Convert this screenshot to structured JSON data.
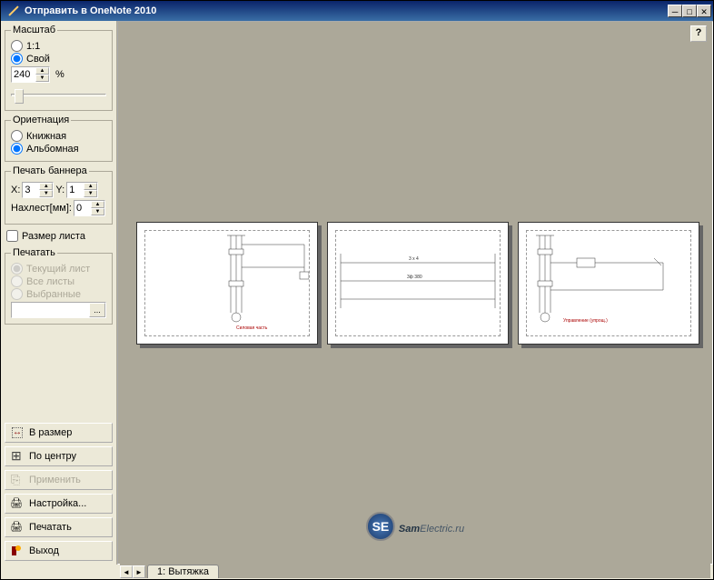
{
  "window": {
    "title": "Отправить в OneNote 2010"
  },
  "scale": {
    "legend": "Масштаб",
    "opt_11": "1:1",
    "opt_custom": "Свой",
    "value": "240",
    "pct": "%"
  },
  "orient": {
    "legend": "Ориетнация",
    "portrait": "Книжная",
    "landscape": "Альбомная"
  },
  "banner": {
    "legend": "Печать баннера",
    "x_label": "X:",
    "x_value": "3",
    "y_label": "Y:",
    "y_value": "1",
    "overlap_label": "Нахлест[мм]:",
    "overlap_value": "0"
  },
  "sheet_size": "Размер листа",
  "print": {
    "legend": "Печатать",
    "current": "Текущий лист",
    "all": "Все листы",
    "selected": "Выбранные"
  },
  "buttons": {
    "fit": "В размер",
    "center": "По центру",
    "apply": "Применить",
    "setup": "Настройка...",
    "print": "Печатать",
    "exit": "Выход"
  },
  "help": "?",
  "tab": {
    "label": "1: Вытяжка"
  },
  "watermark": {
    "badge": "SE",
    "text1": "Sam",
    "text2": "Electric.ru"
  },
  "winbtns": {
    "min": "—",
    "max": "☐",
    "close": "✕"
  }
}
